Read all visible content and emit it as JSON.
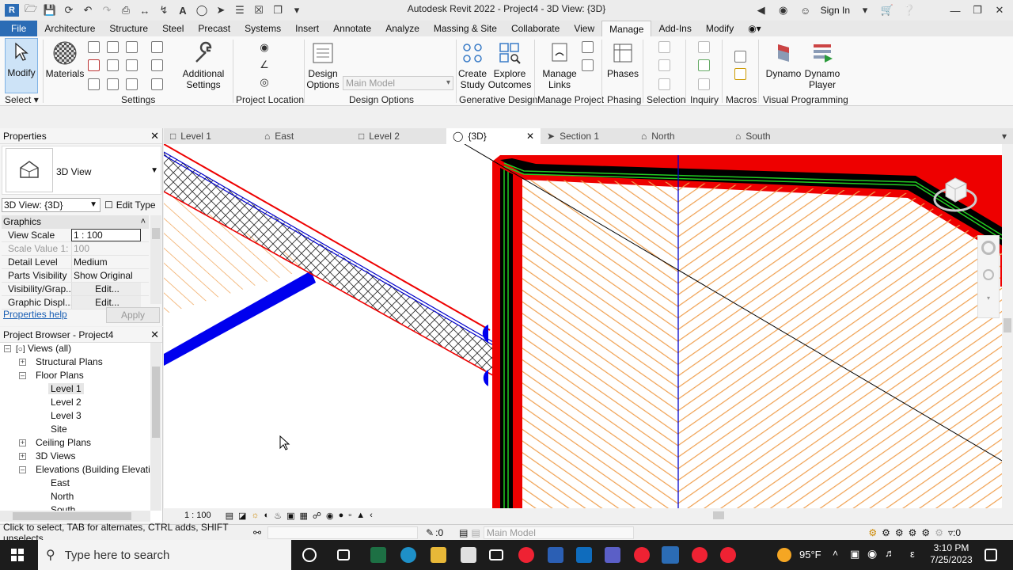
{
  "window": {
    "title": "Autodesk Revit 2022 - Project4 - 3D View: {3D}",
    "sign_in": "Sign In"
  },
  "ribbon_tabs": [
    {
      "label": "File"
    },
    {
      "label": "Architecture"
    },
    {
      "label": "Structure"
    },
    {
      "label": "Steel"
    },
    {
      "label": "Precast"
    },
    {
      "label": "Systems"
    },
    {
      "label": "Insert"
    },
    {
      "label": "Annotate"
    },
    {
      "label": "Analyze"
    },
    {
      "label": "Massing & Site"
    },
    {
      "label": "Collaborate"
    },
    {
      "label": "View"
    },
    {
      "label": "Manage"
    },
    {
      "label": "Add-Ins"
    },
    {
      "label": "Modify"
    }
  ],
  "ribbon": {
    "modify": "Modify",
    "select": "Select",
    "materials": "Materials",
    "additional_settings_1": "Additional",
    "additional_settings_2": "Settings",
    "settings_panel": "Settings",
    "project_location_panel": "Project Location",
    "design_options_1": "Design",
    "design_options_2": "Options",
    "main_model": "Main Model",
    "design_options_panel": "Design Options",
    "create_study_1": "Create",
    "create_study_2": "Study",
    "explore_outcomes_1": "Explore",
    "explore_outcomes_2": "Outcomes",
    "generative_design_panel": "Generative Design",
    "manage_links_1": "Manage",
    "manage_links_2": "Links",
    "manage_project_panel": "Manage Project",
    "phases": "Phases",
    "phasing_panel": "Phasing",
    "selection_panel": "Selection",
    "inquiry_panel": "Inquiry",
    "macros_panel": "Macros",
    "dynamo": "Dynamo",
    "dynamo_player_1": "Dynamo",
    "dynamo_player_2": "Player",
    "visual_programming_panel": "Visual Programming"
  },
  "properties": {
    "title": "Properties",
    "type_name": "3D View",
    "view_selector": "3D View: {3D}",
    "edit_type": "Edit Type",
    "group": "Graphics",
    "rows": [
      {
        "key": "View Scale",
        "value": "1 : 100"
      },
      {
        "key": "Scale Value    1:",
        "value": "100"
      },
      {
        "key": "Detail Level",
        "value": "Medium"
      },
      {
        "key": "Parts Visibility",
        "value": "Show Original"
      },
      {
        "key": "Visibility/Grap...",
        "value": "Edit..."
      },
      {
        "key": "Graphic Displ...",
        "value": "Edit..."
      }
    ],
    "help_link": "Properties help",
    "apply": "Apply"
  },
  "browser": {
    "title": "Project Browser - Project4",
    "items": [
      {
        "label": "Views (all)"
      },
      {
        "label": "Structural Plans"
      },
      {
        "label": "Floor Plans"
      },
      {
        "label": "Level 1"
      },
      {
        "label": "Level 2"
      },
      {
        "label": "Level 3"
      },
      {
        "label": "Site"
      },
      {
        "label": "Ceiling Plans"
      },
      {
        "label": "3D Views"
      },
      {
        "label": "Elevations (Building Elevation"
      },
      {
        "label": "East"
      },
      {
        "label": "North"
      },
      {
        "label": "South"
      }
    ]
  },
  "view_tabs": [
    {
      "label": "Level 1"
    },
    {
      "label": "East"
    },
    {
      "label": "Level 2"
    },
    {
      "label": "{3D}"
    },
    {
      "label": "Section 1"
    },
    {
      "label": "North"
    },
    {
      "label": "South"
    }
  ],
  "view_control": {
    "scale": "1 : 100"
  },
  "status": {
    "message": "Click to select, TAB for alternates, CTRL adds, SHIFT unselects.",
    "worksets": ":0",
    "design_option": "Main Model",
    "filter_count": ":0"
  },
  "taskbar": {
    "search_placeholder": "Type here to search",
    "temperature": "95°F",
    "time": "3:10 PM",
    "date": "7/25/2023",
    "language": "ε"
  },
  "colors": {
    "hatch": "#f0a050",
    "wall_red": "#ff0000",
    "beam_blue": "#0000ee",
    "ribbon_file": "#2b6cb5"
  }
}
